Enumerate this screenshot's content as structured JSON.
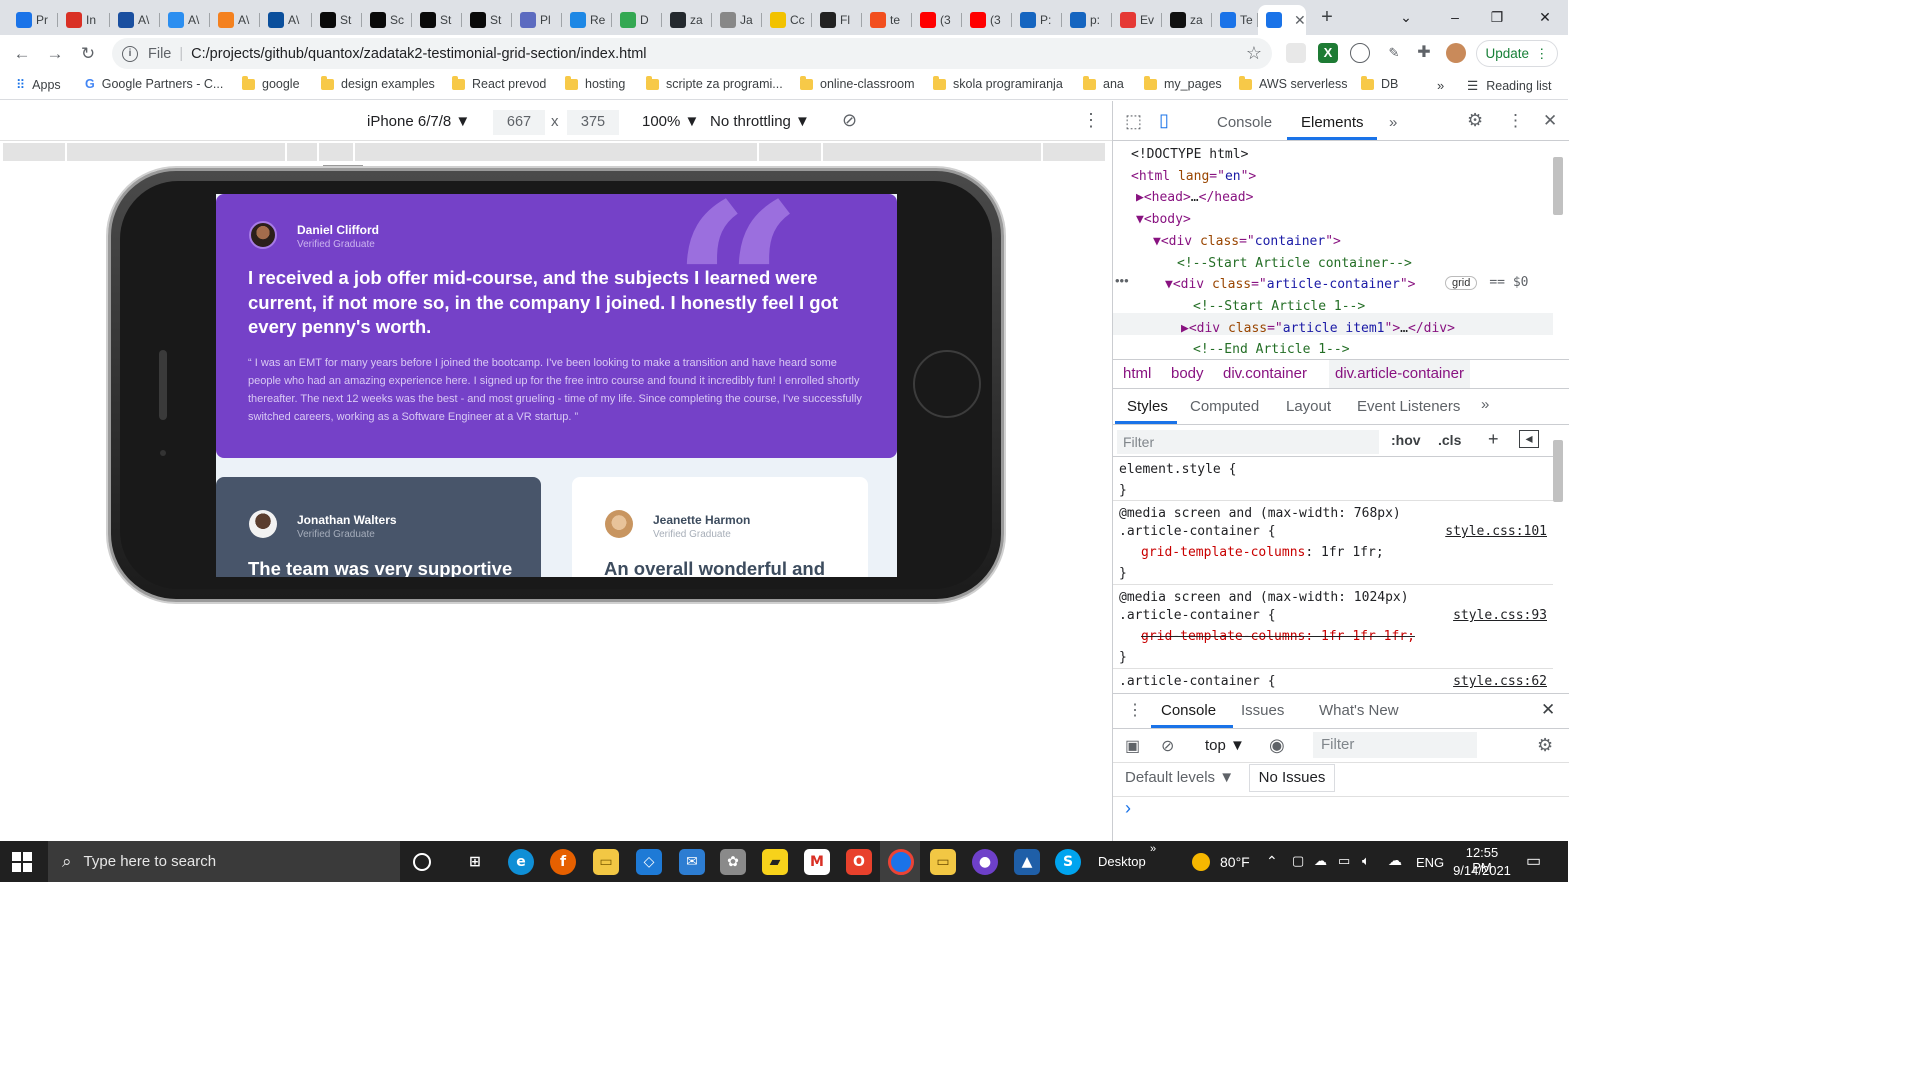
{
  "browser": {
    "tabs": [
      {
        "label": "Pr",
        "icon": "chrome-icon",
        "color": "#1a73e8"
      },
      {
        "label": "In",
        "icon": "gmail-icon",
        "color": "#d93025"
      },
      {
        "label": "A\\",
        "icon": "calendar-icon",
        "color": "#1a4fa0"
      },
      {
        "label": "A\\",
        "icon": "u-icon",
        "color": "#2b8ef0"
      },
      {
        "label": "A\\",
        "icon": "hex-icon",
        "color": "#f4811f"
      },
      {
        "label": "A\\",
        "icon": "terminal-icon",
        "color": "#0b4f9c"
      },
      {
        "label": "St",
        "icon": "dev-icon",
        "color": "#0a0a0a"
      },
      {
        "label": "Sc",
        "icon": "dev-icon",
        "color": "#0a0a0a"
      },
      {
        "label": "St",
        "icon": "dev-icon",
        "color": "#0a0a0a"
      },
      {
        "label": "St",
        "icon": "dev-icon",
        "color": "#0a0a0a"
      },
      {
        "label": "Pl",
        "icon": "robot-icon",
        "color": "#5c6bc0"
      },
      {
        "label": "Re",
        "icon": "cloud-icon",
        "color": "#1e88e5"
      },
      {
        "label": "D",
        "icon": "drive-icon",
        "color": "#34a853"
      },
      {
        "label": "za",
        "icon": "github-icon",
        "color": "#24292e"
      },
      {
        "label": "Ja",
        "icon": "w3-icon",
        "color": "#888888"
      },
      {
        "label": "Cc",
        "icon": "crown-icon",
        "color": "#f2c200"
      },
      {
        "label": "Fl",
        "icon": "trello-icon",
        "color": "#222222"
      },
      {
        "label": "te",
        "icon": "figma-icon",
        "color": "#f24e1e"
      },
      {
        "label": "(3",
        "icon": "youtube-icon",
        "color": "#ff0000"
      },
      {
        "label": "(3",
        "icon": "youtube-icon",
        "color": "#ff0000"
      },
      {
        "label": "P:",
        "icon": "c-icon",
        "color": "#1565c0"
      },
      {
        "label": "p:",
        "icon": "c-icon",
        "color": "#1565c0"
      },
      {
        "label": "Ev",
        "icon": "s-icon",
        "color": "#e53935"
      },
      {
        "label": "za",
        "icon": "a-icon",
        "color": "#111111"
      },
      {
        "label": "Te",
        "icon": "chrome-icon",
        "color": "#1a73e8"
      },
      {
        "label": "",
        "icon": "chrome-icon",
        "color": "#1a73e8"
      }
    ],
    "window_controls": [
      "⌄",
      "–",
      "❐",
      "✕"
    ],
    "address": {
      "scheme": "File",
      "url": "C:/projects/github/quantox/zadatak2-testimonial-grid-section/index.html"
    },
    "update_label": "Update",
    "bookmarks": [
      {
        "label": "Apps",
        "type": "apps"
      },
      {
        "label": "Google Partners - C...",
        "type": "google"
      },
      {
        "label": "google",
        "type": "folder"
      },
      {
        "label": "design examples",
        "type": "folder"
      },
      {
        "label": "React prevod",
        "type": "folder"
      },
      {
        "label": "hosting",
        "type": "folder"
      },
      {
        "label": "scripte za programi...",
        "type": "folder"
      },
      {
        "label": "online-classroom",
        "type": "folder"
      },
      {
        "label": "skola programiranja",
        "type": "folder"
      },
      {
        "label": "ana",
        "type": "folder"
      },
      {
        "label": "my_pages",
        "type": "folder"
      },
      {
        "label": "AWS serverless",
        "type": "folder"
      },
      {
        "label": "DB",
        "type": "folder"
      }
    ],
    "bookmarks_overflow": "»",
    "reading_list": "Reading list"
  },
  "device_toolbar": {
    "device": "iPhone 6/7/8",
    "width": "667",
    "times": "x",
    "height": "375",
    "zoom": "100%",
    "throttle": "No throttling"
  },
  "testimonials": [
    {
      "name": "Daniel Clifford",
      "role": "Verified Graduate",
      "headline": "I received a job offer mid-course, and the subjects I learned were current, if not more so, in the company I joined. I honestly feel I got every penny's worth.",
      "body": "“ I was an EMT for many years before I joined the bootcamp. I've been looking to make a transition and have heard some people who had an amazing experience here. I signed up for the free intro course and found it incredibly fun! I enrolled shortly thereafter. The next 12 weeks was the best - and most grueling - time of my life. Since completing the course, I've successfully switched careers, working as a Software Engineer at a VR startup. ”",
      "bg": "#7541c8"
    },
    {
      "name": "Jonathan Walters",
      "role": "Verified Graduate",
      "headline": "The team was very supportive",
      "bg": "#48556a"
    },
    {
      "name": "Jeanette Harmon",
      "role": "Verified Graduate",
      "headline": "An overall wonderful and",
      "bg": "#ffffff"
    }
  ],
  "devtools": {
    "tabs": [
      "Console",
      "Elements"
    ],
    "more": "»",
    "dom_lines": [
      {
        "parts": [
          [
            "pl",
            "<!DOCTYPE html>"
          ]
        ],
        "indent": 0
      },
      {
        "parts": [
          [
            "tag",
            "<html "
          ],
          [
            "an",
            "lang"
          ],
          [
            "tag",
            "=\""
          ],
          [
            "av",
            "en"
          ],
          [
            "tag",
            "\">"
          ]
        ],
        "indent": 0
      },
      {
        "parts": [
          [
            "tag",
            "▶<head>"
          ],
          [
            "pl",
            "…"
          ],
          [
            "tag",
            "</head>"
          ]
        ],
        "indent": 1
      },
      {
        "parts": [
          [
            "tag",
            "▼<body>"
          ]
        ],
        "indent": 1
      },
      {
        "parts": [
          [
            "tag",
            "▼<div "
          ],
          [
            "an",
            "class"
          ],
          [
            "tag",
            "=\""
          ],
          [
            "av",
            "container"
          ],
          [
            "tag",
            "\">"
          ]
        ],
        "indent": 2
      },
      {
        "parts": [
          [
            "cm",
            "<!--Start Article container-->"
          ]
        ],
        "indent": 3
      },
      {
        "parts": [
          [
            "tag",
            "▼<div "
          ],
          [
            "an",
            "class"
          ],
          [
            "tag",
            "=\""
          ],
          [
            "av",
            "article-container"
          ],
          [
            "tag",
            "\">"
          ]
        ],
        "indent": 3
      },
      {
        "parts": [
          [
            "cm",
            "<!--Start Article 1-->"
          ]
        ],
        "indent": 4
      },
      {
        "parts": [
          [
            "tag",
            "▶<div "
          ],
          [
            "an",
            "class"
          ],
          [
            "tag",
            "=\""
          ],
          [
            "av",
            "article item1"
          ],
          [
            "tag",
            "\">"
          ],
          [
            "pl",
            "…"
          ],
          [
            "tag",
            "</div>"
          ]
        ],
        "indent": 4
      },
      {
        "parts": [
          [
            "cm",
            "<!--End Article 1-->"
          ]
        ],
        "indent": 4
      }
    ],
    "grid_badge": "grid",
    "sel_marker": "== $0",
    "breadcrumbs": [
      "html",
      "body",
      "div.container",
      "div.article-container"
    ],
    "style_tabs": [
      "Styles",
      "Computed",
      "Layout",
      "Event Listeners"
    ],
    "filter_placeholder": "Filter",
    "hov": ":hov",
    "cls": ".cls",
    "rules": [
      {
        "lines": [
          "element.style {",
          "}"
        ]
      },
      {
        "media": "@media screen and (max-width: 768px)",
        "selector": ".article-container {",
        "prop": "grid-template-columns",
        "val": "1fr 1fr;",
        "link": "style.css:101",
        "struck": false
      },
      {
        "media": "@media screen and (max-width: 1024px)",
        "selector": ".article-container {",
        "prop": "grid-template-columns",
        "val": "1fr 1fr 1fr;",
        "link": "style.css:93",
        "struck": true
      },
      {
        "selector": ".article-container {",
        "link": "style.css:62"
      }
    ],
    "drawer_tabs": [
      "Console",
      "Issues",
      "What's New"
    ],
    "context": "top",
    "drawer_filter": "Filter",
    "levels": "Default levels",
    "issues": "No Issues",
    "prompt": "›"
  },
  "taskbar": {
    "search_placeholder": "Type here to search",
    "desktop": "Desktop",
    "weather": "80°F",
    "lang": "ENG",
    "time": "12:55 PM",
    "date": "9/14/2021",
    "overflow": "»"
  }
}
